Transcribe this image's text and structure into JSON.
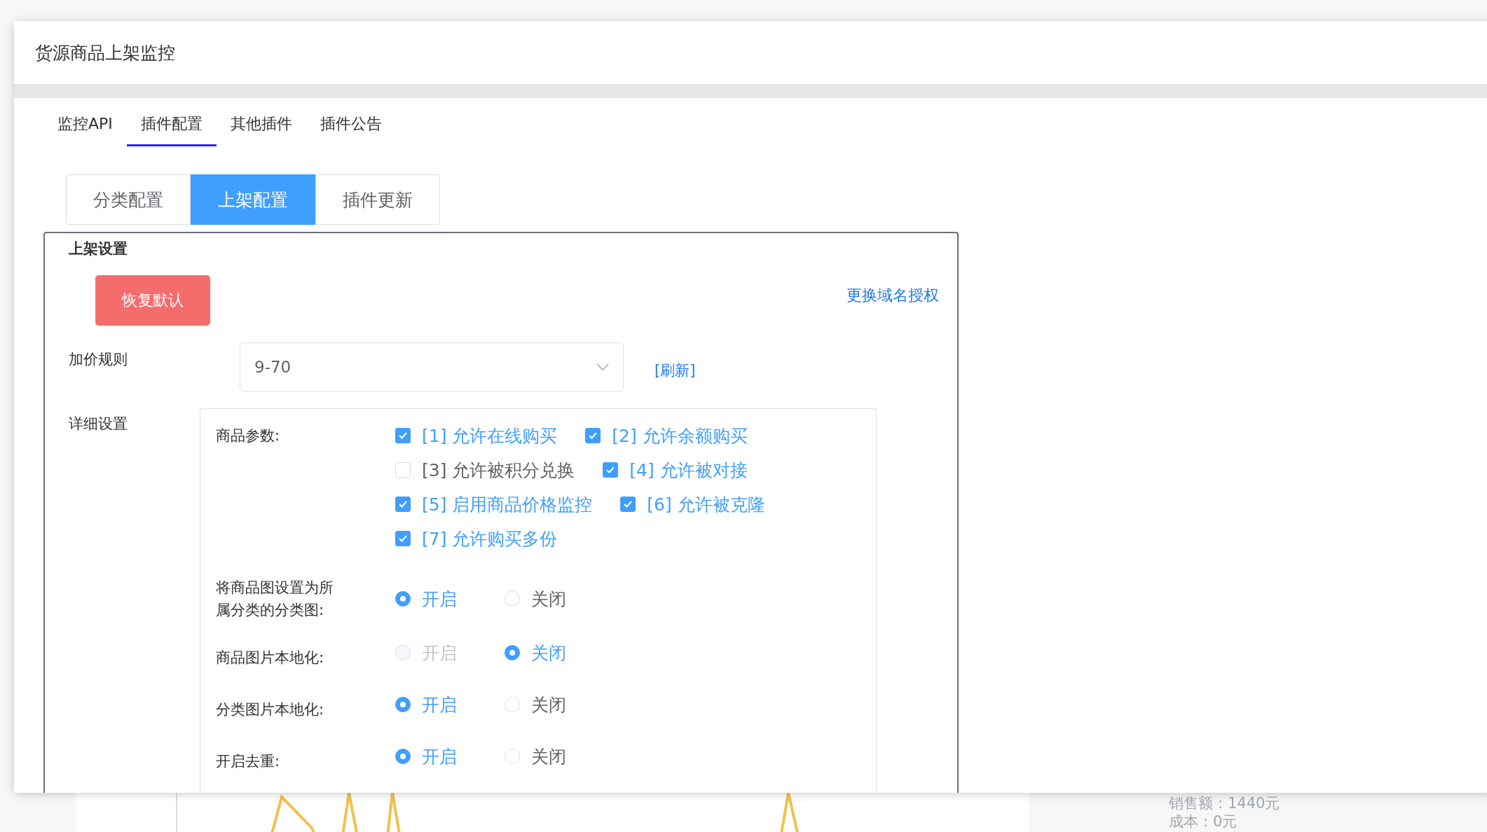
{
  "background": {
    "stats": [
      "销售额：1440元",
      "成本：0元"
    ]
  },
  "dialog": {
    "title": "货源商品上架监控",
    "tabs": [
      {
        "label": "监控API",
        "selected": false
      },
      {
        "label": "插件配置",
        "selected": true
      },
      {
        "label": "其他插件",
        "selected": false
      },
      {
        "label": "插件公告",
        "selected": false
      }
    ],
    "segments": [
      {
        "label": "分类配置",
        "selected": false
      },
      {
        "label": "上架配置",
        "selected": true
      },
      {
        "label": "插件更新",
        "selected": false
      }
    ],
    "section": {
      "legend": "上架设置",
      "reset_button": "恢复默认",
      "link": "更换域名授权",
      "price_rule": {
        "label": "加价规则",
        "value": "9-70",
        "refresh": "[刷新]"
      },
      "detail": {
        "label": "详细设置",
        "params_label": "商品参数:",
        "params": [
          {
            "label": "[1] 允许在线购买",
            "checked": true
          },
          {
            "label": "[2] 允许余额购买",
            "checked": true
          },
          {
            "label": "[3] 允许被积分兑换",
            "checked": false
          },
          {
            "label": "[4] 允许被对接",
            "checked": true
          },
          {
            "label": "[5] 启用商品价格监控",
            "checked": true
          },
          {
            "label": "[6] 允许被克隆",
            "checked": true
          },
          {
            "label": "[7] 允许购买多份",
            "checked": true
          }
        ],
        "options": [
          {
            "label": "将商品图设置为所属分类的分类图:",
            "choices": [
              {
                "label": "开启",
                "selected": true,
                "disabled": false
              },
              {
                "label": "关闭",
                "selected": false,
                "disabled": false
              }
            ]
          },
          {
            "label": "商品图片本地化:",
            "choices": [
              {
                "label": "开启",
                "selected": false,
                "disabled": true
              },
              {
                "label": "关闭",
                "selected": true,
                "disabled": false
              }
            ]
          },
          {
            "label": "分类图片本地化:",
            "choices": [
              {
                "label": "开启",
                "selected": true,
                "disabled": false
              },
              {
                "label": "关闭",
                "selected": false,
                "disabled": false
              }
            ]
          },
          {
            "label": "开启去重:",
            "choices": [
              {
                "label": "开启",
                "selected": true,
                "disabled": false
              },
              {
                "label": "关闭",
                "selected": false,
                "disabled": false
              }
            ]
          }
        ]
      }
    }
  }
}
